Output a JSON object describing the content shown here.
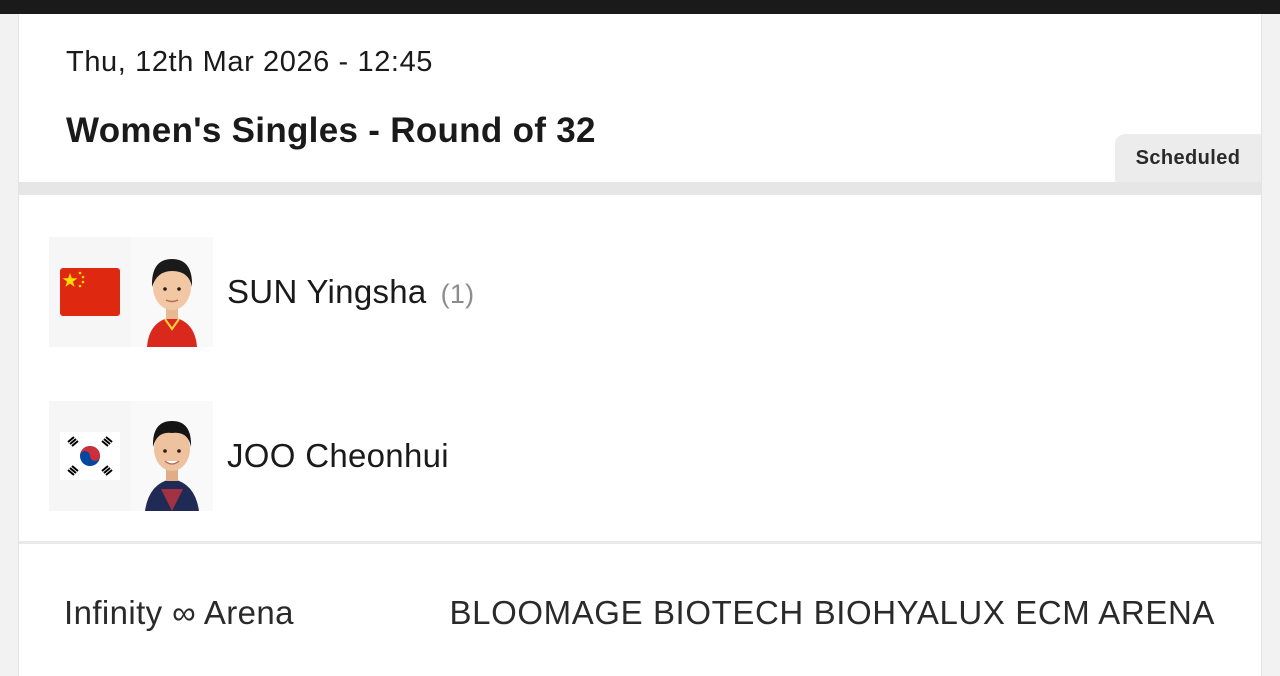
{
  "match": {
    "datetime": "Thu, 12th Mar 2026 - 12:45",
    "title": "Women's Singles - Round of 32",
    "status": "Scheduled"
  },
  "players": [
    {
      "name": "SUN Yingsha",
      "seed": "(1)",
      "flag_icon": "china-flag-icon",
      "photo_icon": "player-photo-sun-yingsha"
    },
    {
      "name": "JOO Cheonhui",
      "seed": "",
      "flag_icon": "south-korea-flag-icon",
      "photo_icon": "player-photo-joo-cheonhui"
    }
  ],
  "footer": {
    "venue": "Infinity ∞ Arena",
    "arena_name": "BLOOMAGE BIOTECH BIOHYALUX ECM ARENA"
  },
  "colors": {
    "china_red": "#de2910",
    "china_star": "#ffde00",
    "korea_red": "#cd2e3a",
    "korea_blue": "#0047a0",
    "status_bg": "#ececec"
  }
}
